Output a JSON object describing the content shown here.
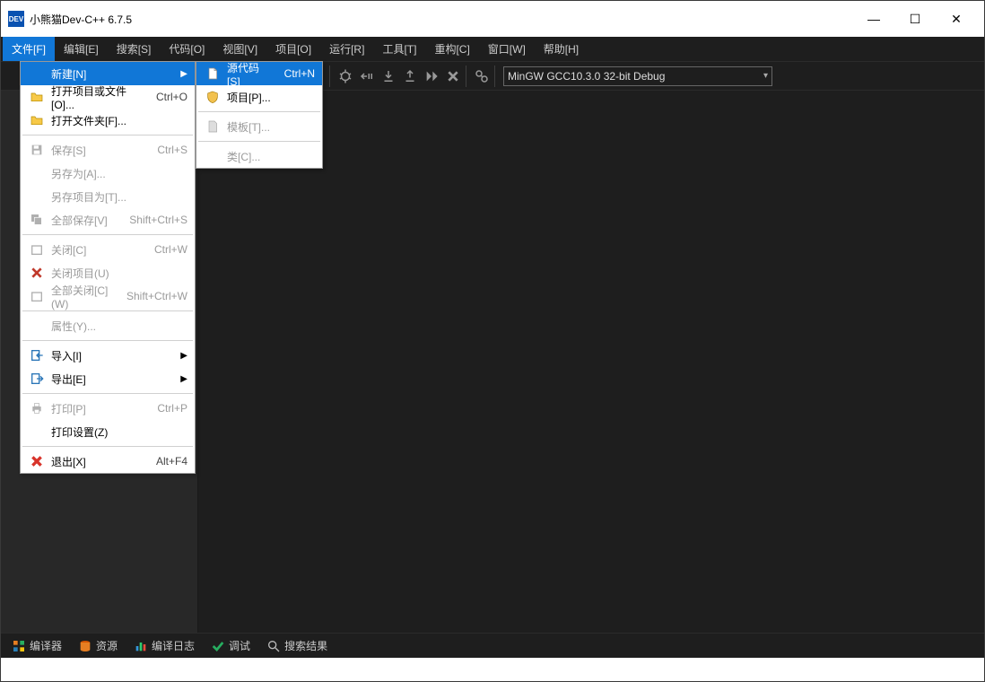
{
  "titlebar": {
    "title": "小熊猫Dev-C++ 6.7.5",
    "app_icon_text": "DEV"
  },
  "winbuttons": {
    "min": "—",
    "max": "☐",
    "close": "✕"
  },
  "menubar": [
    {
      "label": "文件[F]",
      "active": true
    },
    {
      "label": "编辑[E]"
    },
    {
      "label": "搜索[S]"
    },
    {
      "label": "代码[O]"
    },
    {
      "label": "视图[V]"
    },
    {
      "label": "项目[O]"
    },
    {
      "label": "运行[R]"
    },
    {
      "label": "工具[T]"
    },
    {
      "label": "重构[C]"
    },
    {
      "label": "窗口[W]"
    },
    {
      "label": "帮助[H]"
    }
  ],
  "toolbar": {
    "combo_label": "MinGW GCC10.3.0 32-bit Debug"
  },
  "file_menu": [
    {
      "type": "item",
      "label": "新建[N]",
      "highlight": true,
      "submenu": true,
      "icon": "none"
    },
    {
      "type": "item",
      "label": "打开项目或文件[O]...",
      "shortcut": "Ctrl+O",
      "icon": "folder"
    },
    {
      "type": "item",
      "label": "打开文件夹[F]...",
      "icon": "folder"
    },
    {
      "type": "sep"
    },
    {
      "type": "item",
      "label": "保存[S]",
      "shortcut": "Ctrl+S",
      "disabled": true,
      "icon": "disk"
    },
    {
      "type": "item",
      "label": "另存为[A]...",
      "disabled": true,
      "icon": "none"
    },
    {
      "type": "item",
      "label": "另存项目为[T]...",
      "disabled": true,
      "icon": "none"
    },
    {
      "type": "item",
      "label": "全部保存[V]",
      "shortcut": "Shift+Ctrl+S",
      "disabled": true,
      "icon": "disks"
    },
    {
      "type": "sep"
    },
    {
      "type": "item",
      "label": "关闭[C]",
      "shortcut": "Ctrl+W",
      "disabled": true,
      "icon": "close"
    },
    {
      "type": "item",
      "label": "关闭项目(U)",
      "disabled": true,
      "icon": "close-red"
    },
    {
      "type": "item",
      "label": "全部关闭[C](W)",
      "shortcut": "Shift+Ctrl+W",
      "disabled": true,
      "icon": "close"
    },
    {
      "type": "sep"
    },
    {
      "type": "item",
      "label": "属性(Y)...",
      "disabled": true,
      "icon": "none"
    },
    {
      "type": "sep"
    },
    {
      "type": "item",
      "label": "导入[I]",
      "submenu": true,
      "icon": "import"
    },
    {
      "type": "item",
      "label": "导出[E]",
      "submenu": true,
      "icon": "export"
    },
    {
      "type": "sep"
    },
    {
      "type": "item",
      "label": "打印[P]",
      "shortcut": "Ctrl+P",
      "disabled": true,
      "icon": "print"
    },
    {
      "type": "item",
      "label": "打印设置(Z)",
      "icon": "none"
    },
    {
      "type": "sep"
    },
    {
      "type": "item",
      "label": "退出[X]",
      "shortcut": "Alt+F4",
      "icon": "exit"
    }
  ],
  "new_submenu": [
    {
      "type": "item",
      "label": "源代码[S]",
      "shortcut": "Ctrl+N",
      "highlight": true,
      "icon": "page"
    },
    {
      "type": "item",
      "label": "项目[P]...",
      "icon": "shield"
    },
    {
      "type": "sep"
    },
    {
      "type": "item",
      "label": "模板[T]...",
      "disabled": true,
      "icon": "page-gray"
    },
    {
      "type": "sep"
    },
    {
      "type": "item",
      "label": "类[C]...",
      "disabled": true,
      "icon": "none"
    }
  ],
  "bottomtabs": [
    {
      "label": "编译器",
      "icon": "grid"
    },
    {
      "label": "资源",
      "icon": "db"
    },
    {
      "label": "编译日志",
      "icon": "bars"
    },
    {
      "label": "调试",
      "icon": "check"
    },
    {
      "label": "搜索结果",
      "icon": "search"
    }
  ]
}
